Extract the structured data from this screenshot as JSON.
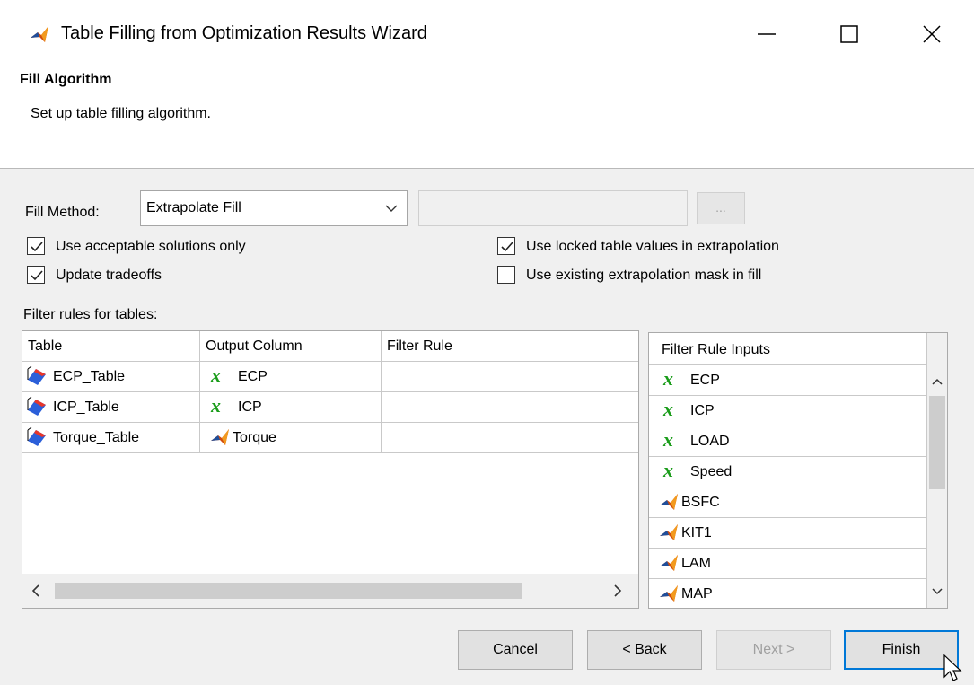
{
  "window": {
    "title": "Table Filling from Optimization Results Wizard",
    "icon": "matlab-icon"
  },
  "header": {
    "title": "Fill Algorithm",
    "subtitle": "Set up table filling algorithm."
  },
  "fill_method": {
    "label": "Fill Method:",
    "value": "Extrapolate Fill",
    "extra_field_value": "",
    "browse_label": "..."
  },
  "options": {
    "acceptable_only": {
      "label": "Use acceptable solutions only",
      "checked": true
    },
    "update_tradeoffs": {
      "label": "Update tradeoffs",
      "checked": true
    },
    "locked_values": {
      "label": "Use locked table values in extrapolation",
      "checked": true
    },
    "existing_mask": {
      "label": "Use existing extrapolation mask in fill",
      "checked": false
    }
  },
  "filter_rules": {
    "label": "Filter rules for tables:",
    "columns": [
      "Table",
      "Output Column",
      "Filter Rule"
    ],
    "rows": [
      {
        "table": "ECP_Table",
        "output_icon": "x",
        "output": "ECP",
        "rule": ""
      },
      {
        "table": "ICP_Table",
        "output_icon": "x",
        "output": "ICP",
        "rule": ""
      },
      {
        "table": "Torque_Table",
        "output_icon": "matlab",
        "output": "Torque",
        "rule": ""
      }
    ]
  },
  "filter_inputs": {
    "header": "Filter Rule Inputs",
    "items": [
      {
        "icon": "x",
        "label": "ECP"
      },
      {
        "icon": "x",
        "label": "ICP"
      },
      {
        "icon": "x",
        "label": "LOAD"
      },
      {
        "icon": "x",
        "label": "Speed"
      },
      {
        "icon": "matlab",
        "label": "BSFC"
      },
      {
        "icon": "matlab",
        "label": "KIT1"
      },
      {
        "icon": "matlab",
        "label": "LAM"
      },
      {
        "icon": "matlab",
        "label": "MAP"
      }
    ]
  },
  "buttons": {
    "cancel": "Cancel",
    "back": "< Back",
    "next": "Next >",
    "finish": "Finish"
  },
  "x_symbol": "x"
}
